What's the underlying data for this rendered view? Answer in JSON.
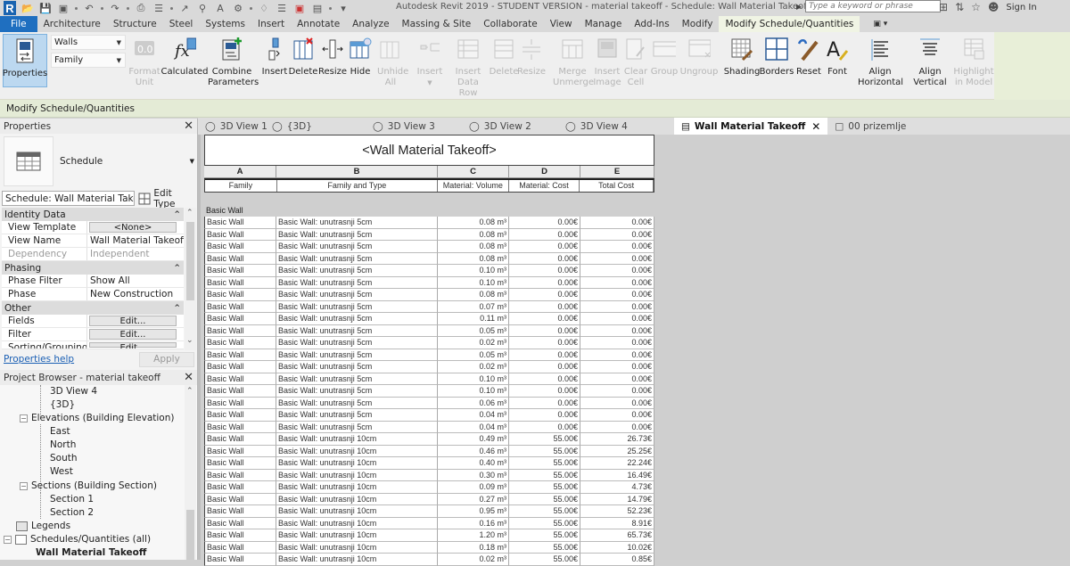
{
  "app": {
    "window_title": "Autodesk Revit 2019 - STUDENT VERSION - material takeoff - Schedule: Wall Material Takeoff",
    "search_placeholder": "Type a keyword or phrase",
    "sign_in": "Sign In"
  },
  "ribbon_tabs": [
    "File",
    "Architecture",
    "Structure",
    "Steel",
    "Systems",
    "Insert",
    "Annotate",
    "Analyze",
    "Massing & Site",
    "Collaborate",
    "View",
    "Manage",
    "Add-Ins",
    "Modify",
    "Modify Schedule/Quantities"
  ],
  "ribbon_active_tab": "Modify Schedule/Quantities",
  "ribbon": {
    "properties": "Properties",
    "category_combo": "Walls",
    "field_combo": "Family",
    "buttons": [
      {
        "id": "format-unit",
        "label": "Format Unit",
        "enabled": false
      },
      {
        "id": "calculated",
        "label": "Calculated",
        "enabled": true
      },
      {
        "id": "combine-parameters",
        "label": "Combine Parameters",
        "enabled": true
      },
      {
        "id": "insert-col",
        "label": "Insert",
        "enabled": true
      },
      {
        "id": "delete-col",
        "label": "Delete",
        "enabled": true
      },
      {
        "id": "resize-col",
        "label": "Resize",
        "enabled": true
      },
      {
        "id": "hide",
        "label": "Hide",
        "enabled": true
      },
      {
        "id": "unhide-all",
        "label": "Unhide All",
        "enabled": false
      },
      {
        "id": "insert-row",
        "label": "Insert",
        "enabled": false
      },
      {
        "id": "insert-data-row",
        "label": "Insert Data Row",
        "enabled": false
      },
      {
        "id": "delete-row",
        "label": "Delete",
        "enabled": false
      },
      {
        "id": "resize-row",
        "label": "Resize",
        "enabled": false
      },
      {
        "id": "merge-unmerge",
        "label": "Merge Unmerge",
        "enabled": false
      },
      {
        "id": "insert-image",
        "label": "Insert Image",
        "enabled": false
      },
      {
        "id": "clear-cell",
        "label": "Clear Cell",
        "enabled": false
      },
      {
        "id": "group",
        "label": "Group",
        "enabled": false
      },
      {
        "id": "ungroup",
        "label": "Ungroup",
        "enabled": false
      },
      {
        "id": "shading",
        "label": "Shading",
        "enabled": true
      },
      {
        "id": "borders",
        "label": "Borders",
        "enabled": true
      },
      {
        "id": "reset",
        "label": "Reset",
        "enabled": true
      },
      {
        "id": "font",
        "label": "Font",
        "enabled": true
      },
      {
        "id": "align-horizontal",
        "label": "Align Horizontal",
        "enabled": true
      },
      {
        "id": "align-vertical",
        "label": "Align Vertical",
        "enabled": true
      },
      {
        "id": "highlight-in-model",
        "label": "Highlight in Model",
        "enabled": false
      }
    ]
  },
  "context_bar": "Modify Schedule/Quantities",
  "properties_panel": {
    "title": "Properties",
    "type_label": "Schedule",
    "instance_select": "Schedule: Wall Material Takec",
    "edit_type": "Edit Type",
    "groups": [
      {
        "name": "Identity Data",
        "rows": [
          {
            "key": "View Template",
            "value": "<None>",
            "button": true
          },
          {
            "key": "View Name",
            "value": "Wall Material Takeoff"
          },
          {
            "key": "Dependency",
            "value": "Independent",
            "dim": true
          }
        ]
      },
      {
        "name": "Phasing",
        "rows": [
          {
            "key": "Phase Filter",
            "value": "Show All"
          },
          {
            "key": "Phase",
            "value": "New Construction"
          }
        ]
      },
      {
        "name": "Other",
        "rows": [
          {
            "key": "Fields",
            "value": "Edit...",
            "button": true
          },
          {
            "key": "Filter",
            "value": "Edit...",
            "button": true
          },
          {
            "key": "Sorting/Grouping",
            "value": "Edit...",
            "button": true
          }
        ]
      }
    ],
    "help_link": "Properties help",
    "apply": "Apply"
  },
  "project_browser": {
    "title": "Project Browser - material takeoff",
    "items": [
      {
        "label": "3D View 4",
        "level": 3
      },
      {
        "label": "{3D}",
        "level": 3
      },
      {
        "label": "Elevations (Building Elevation)",
        "level": 2,
        "expanded": true
      },
      {
        "label": "East",
        "level": 3
      },
      {
        "label": "North",
        "level": 3
      },
      {
        "label": "South",
        "level": 3
      },
      {
        "label": "West",
        "level": 3
      },
      {
        "label": "Sections (Building Section)",
        "level": 2,
        "expanded": true
      },
      {
        "label": "Section 1",
        "level": 3
      },
      {
        "label": "Section 2",
        "level": 3
      },
      {
        "label": "Legends",
        "level": 1,
        "icon": true
      },
      {
        "label": "Schedules/Quantities (all)",
        "level": 1,
        "icon": true,
        "expanded": true
      },
      {
        "label": "Wall Material Takeoff",
        "level": 2,
        "bold": true
      }
    ]
  },
  "view_tabs": [
    {
      "label": "3D View 1",
      "icon": "3d-view"
    },
    {
      "label": "{3D}",
      "icon": "3d-view"
    },
    {
      "label": "3D View 3",
      "icon": "3d-view"
    },
    {
      "label": "3D View 2",
      "icon": "3d-view"
    },
    {
      "label": "3D View 4",
      "icon": "3d-view"
    },
    {
      "label": "Wall Material Takeoff",
      "icon": "schedule",
      "active": true
    },
    {
      "label": "00 prizemlje",
      "icon": "floor-plan"
    }
  ],
  "schedule": {
    "title": "<Wall Material Takeoff>",
    "column_letters": [
      "A",
      "B",
      "C",
      "D",
      "E"
    ],
    "columns": [
      "Family",
      "Family and Type",
      "Material: Volume",
      "Material: Cost",
      "Total Cost"
    ],
    "group_header": "Basic Wall",
    "rows": [
      [
        "Basic Wall",
        "Basic Wall: unutrasnji 5cm",
        "0.08 m³",
        "0.00€",
        "0.00€"
      ],
      [
        "Basic Wall",
        "Basic Wall: unutrasnji 5cm",
        "0.08 m³",
        "0.00€",
        "0.00€"
      ],
      [
        "Basic Wall",
        "Basic Wall: unutrasnji 5cm",
        "0.08 m³",
        "0.00€",
        "0.00€"
      ],
      [
        "Basic Wall",
        "Basic Wall: unutrasnji 5cm",
        "0.08 m³",
        "0.00€",
        "0.00€"
      ],
      [
        "Basic Wall",
        "Basic Wall: unutrasnji 5cm",
        "0.10 m³",
        "0.00€",
        "0.00€"
      ],
      [
        "Basic Wall",
        "Basic Wall: unutrasnji 5cm",
        "0.10 m³",
        "0.00€",
        "0.00€"
      ],
      [
        "Basic Wall",
        "Basic Wall: unutrasnji 5cm",
        "0.08 m³",
        "0.00€",
        "0.00€"
      ],
      [
        "Basic Wall",
        "Basic Wall: unutrasnji 5cm",
        "0.07 m³",
        "0.00€",
        "0.00€"
      ],
      [
        "Basic Wall",
        "Basic Wall: unutrasnji 5cm",
        "0.11 m³",
        "0.00€",
        "0.00€"
      ],
      [
        "Basic Wall",
        "Basic Wall: unutrasnji 5cm",
        "0.05 m³",
        "0.00€",
        "0.00€"
      ],
      [
        "Basic Wall",
        "Basic Wall: unutrasnji 5cm",
        "0.02 m³",
        "0.00€",
        "0.00€"
      ],
      [
        "Basic Wall",
        "Basic Wall: unutrasnji 5cm",
        "0.05 m³",
        "0.00€",
        "0.00€"
      ],
      [
        "Basic Wall",
        "Basic Wall: unutrasnji 5cm",
        "0.02 m³",
        "0.00€",
        "0.00€"
      ],
      [
        "Basic Wall",
        "Basic Wall: unutrasnji 5cm",
        "0.10 m³",
        "0.00€",
        "0.00€"
      ],
      [
        "Basic Wall",
        "Basic Wall: unutrasnji 5cm",
        "0.10 m³",
        "0.00€",
        "0.00€"
      ],
      [
        "Basic Wall",
        "Basic Wall: unutrasnji 5cm",
        "0.06 m³",
        "0.00€",
        "0.00€"
      ],
      [
        "Basic Wall",
        "Basic Wall: unutrasnji 5cm",
        "0.04 m³",
        "0.00€",
        "0.00€"
      ],
      [
        "Basic Wall",
        "Basic Wall: unutrasnji 5cm",
        "0.04 m³",
        "0.00€",
        "0.00€"
      ],
      [
        "Basic Wall",
        "Basic Wall: unutrasnji 10cm",
        "0.49 m³",
        "55.00€",
        "26.73€"
      ],
      [
        "Basic Wall",
        "Basic Wall: unutrasnji 10cm",
        "0.46 m³",
        "55.00€",
        "25.25€"
      ],
      [
        "Basic Wall",
        "Basic Wall: unutrasnji 10cm",
        "0.40 m³",
        "55.00€",
        "22.24€"
      ],
      [
        "Basic Wall",
        "Basic Wall: unutrasnji 10cm",
        "0.30 m³",
        "55.00€",
        "16.49€"
      ],
      [
        "Basic Wall",
        "Basic Wall: unutrasnji 10cm",
        "0.09 m³",
        "55.00€",
        "4.73€"
      ],
      [
        "Basic Wall",
        "Basic Wall: unutrasnji 10cm",
        "0.27 m³",
        "55.00€",
        "14.79€"
      ],
      [
        "Basic Wall",
        "Basic Wall: unutrasnji 10cm",
        "0.95 m³",
        "55.00€",
        "52.23€"
      ],
      [
        "Basic Wall",
        "Basic Wall: unutrasnji 10cm",
        "0.16 m³",
        "55.00€",
        "8.91€"
      ],
      [
        "Basic Wall",
        "Basic Wall: unutrasnji 10cm",
        "1.20 m³",
        "55.00€",
        "65.73€"
      ],
      [
        "Basic Wall",
        "Basic Wall: unutrasnji 10cm",
        "0.18 m³",
        "55.00€",
        "10.02€"
      ],
      [
        "Basic Wall",
        "Basic Wall: unutrasnji 10cm",
        "0.02 m³",
        "55.00€",
        "0.85€"
      ]
    ]
  },
  "colors": {
    "file_tab": "#1f6fc0",
    "active_tab": "#f0f4e4",
    "context_bar": "#e4ebd6",
    "properties_button": "#bcd8f0",
    "link": "#1a5fb4"
  }
}
